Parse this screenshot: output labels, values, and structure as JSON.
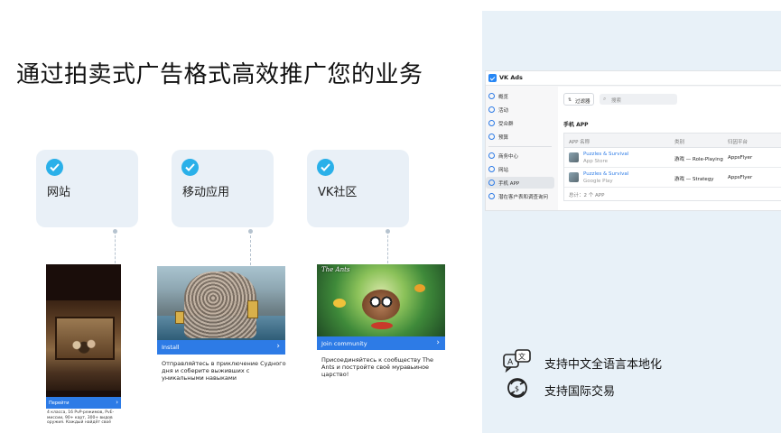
{
  "headline": "通过拍卖式广告格式高效推广您的业务",
  "cards": [
    {
      "label": "网站"
    },
    {
      "label": "移动应用"
    },
    {
      "label": "VK社区"
    }
  ],
  "ads": [
    {
      "cta": "Перейти",
      "caption": "4 класса, 16 PvP-режимов, PvE-миссии, 90+ карт, 300+ видов оружия. Каждый найдёт своё"
    },
    {
      "cta": "Install",
      "caption": "Отправляйтесь в приключение Судного дня и соберите выживших с уникальными навыками"
    },
    {
      "cta": "Join community",
      "logo": "The Ants",
      "caption": "Присоединяйтесь к сообществу The Ants и постройте своё муравьиное царство!"
    }
  ],
  "vk_app": {
    "title": "VK Ads",
    "sidebar": [
      {
        "label": "概览",
        "icon": "overview-icon"
      },
      {
        "label": "活动",
        "icon": "campaign-icon"
      },
      {
        "label": "受众群",
        "icon": "audience-icon"
      },
      {
        "label": "预算",
        "icon": "budget-icon"
      },
      {
        "label": "商务中心",
        "icon": "business-icon"
      },
      {
        "label": "网站",
        "icon": "globe-icon"
      },
      {
        "label": "手机 APP",
        "icon": "phone-icon"
      },
      {
        "label": "潜在客户表和调查询问",
        "icon": "form-icon"
      }
    ],
    "toolbar": {
      "filter_label": "过滤器",
      "search_placeholder": "搜索"
    },
    "section_title": "手机 APP",
    "table": {
      "headers": [
        "APP 名称",
        "类别",
        "归因平台"
      ],
      "rows": [
        {
          "name": "Puzzles & Survival",
          "store": "App Store",
          "category": "游戏 — Role-Playing",
          "attribution": "AppsFlyer"
        },
        {
          "name": "Puzzles & Survival",
          "store": "Google Play",
          "category": "游戏 — Strategy",
          "attribution": "AppsFlyer"
        }
      ],
      "total": "总计：2 个 APP"
    }
  },
  "features": [
    {
      "label": "支持中文全语言本地化",
      "icon": "translate-icon"
    },
    {
      "label": "支持国际交易",
      "icon": "exchange-icon"
    }
  ],
  "colors": {
    "accent": "#2ab0e9",
    "cta_blue": "#2d7be6",
    "card_bg": "#e9f0f7",
    "panel_bg": "#e8f1f8",
    "vk_blue": "#2787f5"
  }
}
